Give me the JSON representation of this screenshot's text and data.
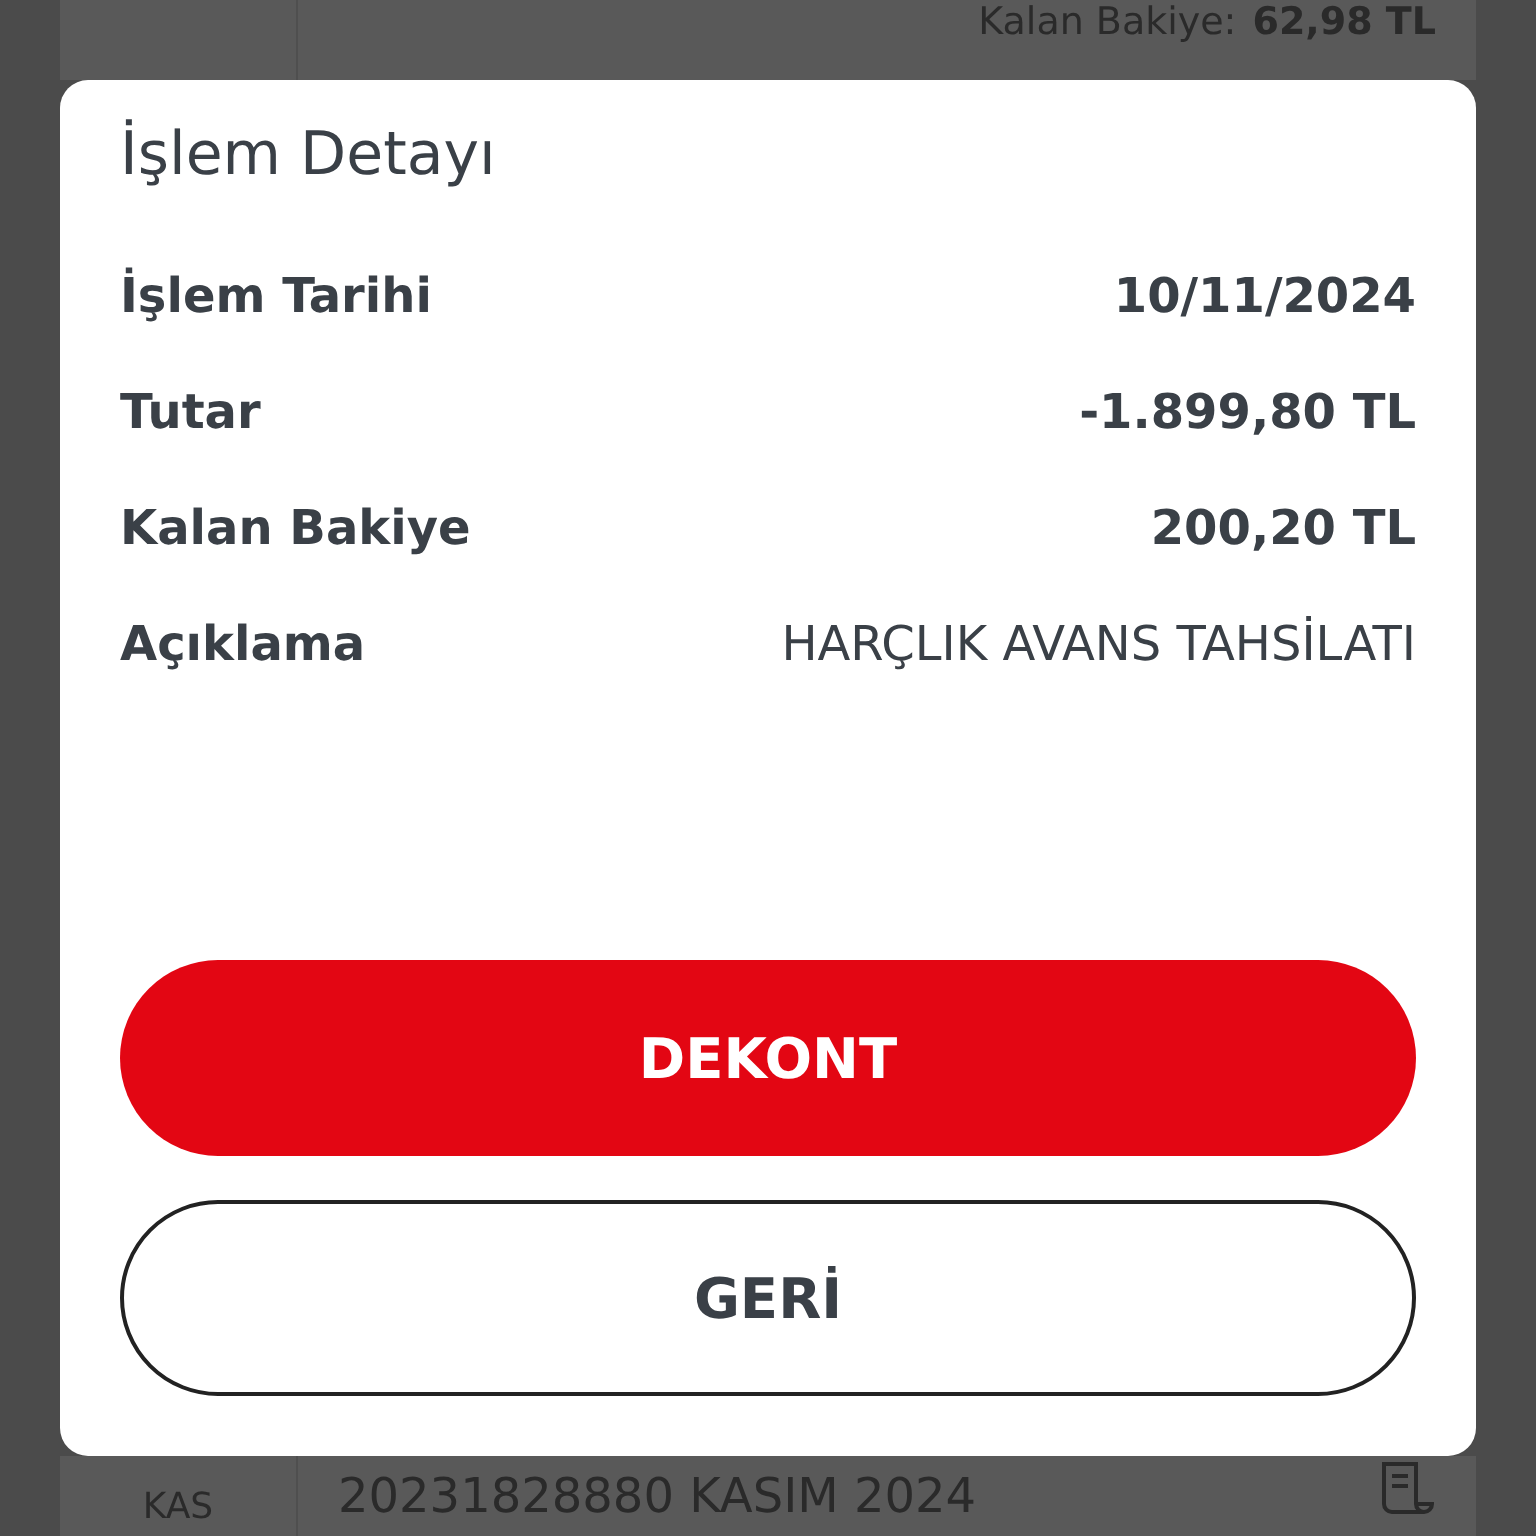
{
  "background_rows": [
    {
      "label": "Kalan Bakiye:",
      "balance": "62,98 TL"
    }
  ],
  "next_row": {
    "month": "KAS",
    "description": "20231828880 KASIM 2024"
  },
  "dialog": {
    "title": "İşlem Detayı",
    "details": [
      {
        "label": "İşlem Tarihi",
        "value": "10/11/2024",
        "kind": "strong"
      },
      {
        "label": "Tutar",
        "value": "-1.899,80 TL",
        "kind": "strong"
      },
      {
        "label": "Kalan Bakiye",
        "value": "200,20 TL",
        "kind": "strong"
      },
      {
        "label": "Açıklama",
        "value": "HARÇLIK AVANS TAHSİLATI",
        "kind": "plain"
      }
    ],
    "buttons": [
      {
        "label": "DEKONT",
        "kind": "primary"
      },
      {
        "label": "GERİ",
        "kind": "secondary"
      }
    ]
  }
}
